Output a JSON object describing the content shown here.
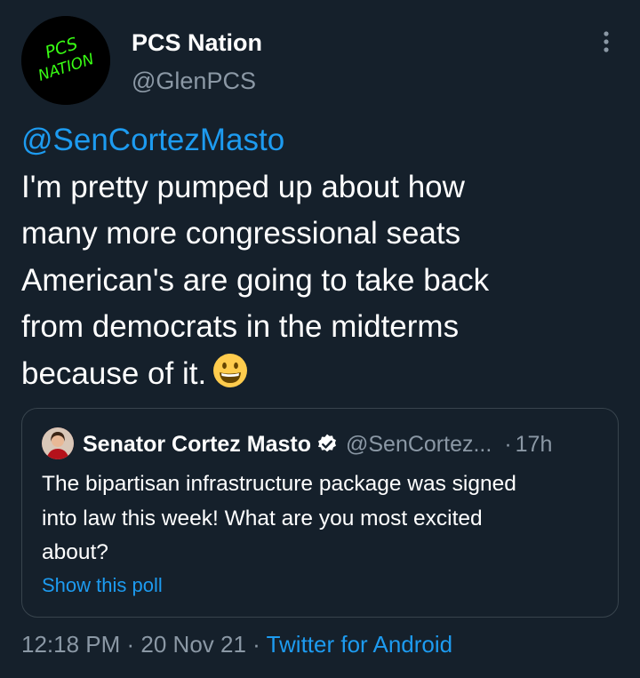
{
  "author": {
    "name": "PCS Nation",
    "handle": "@GlenPCS",
    "avatar_text_top": "PCS",
    "avatar_text_bottom": "NATION",
    "avatar_color": "#39ff14"
  },
  "tweet": {
    "mention": "@SenCortezMasto",
    "lines": [
      "I'm pretty pumped up about how",
      "many more congressional seats",
      "American's are going to take back",
      "from democrats in the midterms",
      "because of it."
    ],
    "emoji": "grinning-face-emoji"
  },
  "quote": {
    "name": "Senator Cortez Masto",
    "handle": "@SenCortez...",
    "separator": "·",
    "time": "17h",
    "verified_icon": "verified-badge-icon",
    "text_lines": [
      "The bipartisan infrastructure package was signed",
      "into law this week! What are you most excited",
      "about?"
    ],
    "poll_link": "Show this poll"
  },
  "meta": {
    "time": "12:18 PM",
    "sep1": " · ",
    "date": "20 Nov 21",
    "sep2": " · ",
    "source": "Twitter for Android"
  },
  "colors": {
    "background": "#15202b",
    "link": "#1d9bf0",
    "secondary_text": "#8b98a5",
    "border": "#38444d"
  }
}
